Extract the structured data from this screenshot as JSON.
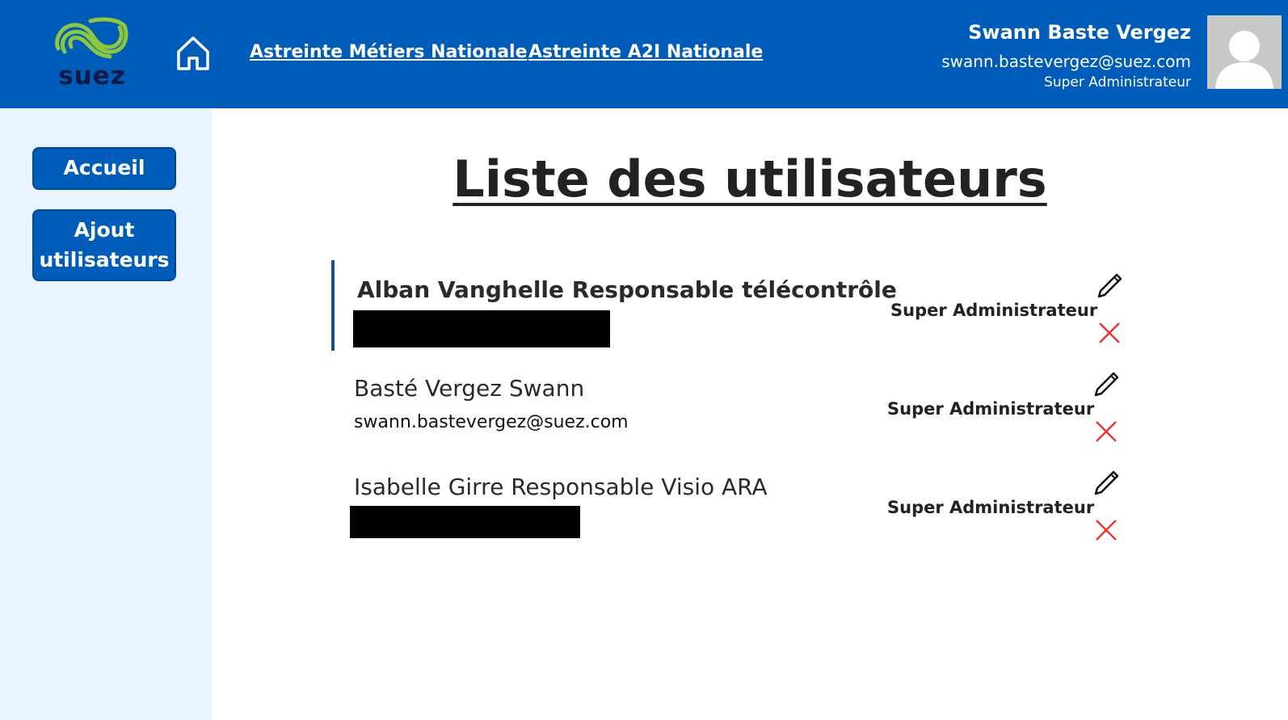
{
  "header": {
    "logo_text": "suez",
    "nav": [
      {
        "label": "Astreinte Métiers Nationale"
      },
      {
        "label": "Astreinte A2I Nationale"
      }
    ],
    "user": {
      "name": "Swann Baste Vergez",
      "email": "swann.bastevergez@suez.com",
      "role": "Super Administrateur"
    }
  },
  "sidebar": {
    "items": [
      {
        "label": "Accueil"
      },
      {
        "label": "Ajout utilisateurs"
      }
    ]
  },
  "main": {
    "title": "Liste des utilisateurs",
    "users": [
      {
        "name": "Alban Vanghelle Responsable télécontrôle",
        "email": "",
        "role": "Super Administrateur"
      },
      {
        "name": "Basté Vergez Swann",
        "email": "swann.bastevergez@suez.com",
        "role": "Super Administrateur"
      },
      {
        "name": " Isabelle Girre Responsable Visio ARA",
        "email": "",
        "role": "Super Administrateur"
      }
    ]
  },
  "colors": {
    "header_bg": "#005cb9",
    "sidebar_bg": "#eaf4ff",
    "delete": "#e53935",
    "logo_green": "#8dc63f"
  }
}
